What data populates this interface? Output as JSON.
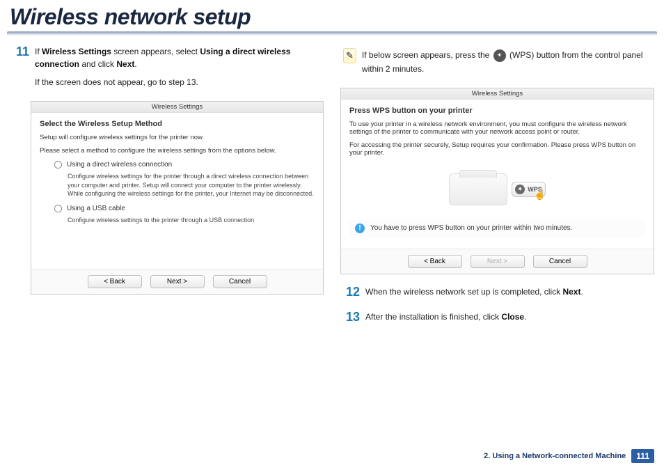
{
  "title": "Wireless network setup",
  "step11": {
    "num": "11",
    "line1_prefix": "If ",
    "line1_b1": "Wireless Settings",
    "line1_mid": " screen appears, select ",
    "line1_b2": "Using a direct wireless connection",
    "line1_end": " and click ",
    "line1_b3": "Next",
    "line1_dot": ".",
    "line2": "If the screen does not appear, go to step 13."
  },
  "dialog1": {
    "title": "Wireless Settings",
    "heading": "Select the Wireless Setup Method",
    "p1": "Setup will configure wireless settings for the printer now.",
    "p2": "Please select a method to configure the wireless settings from the options below.",
    "opt1_label": "Using a direct wireless connection",
    "opt1_desc": "Configure wireless settings for the printer through a direct wireless connection between your computer and printer. Setup will connect your computer to the printer wirelessly.\nWhile configuring the wireless settings for the printer, your Internet may be disconnected.",
    "opt2_label": "Using a USB cable",
    "opt2_desc": "Configure wireless settings to the printer through a USB connection",
    "btn_back": "< Back",
    "btn_next": "Next >",
    "btn_cancel": "Cancel"
  },
  "tip": {
    "text_before": "If below screen appears, press the ",
    "wps_label": "(WPS)",
    "text_after": " button from the control panel within 2 minutes."
  },
  "dialog2": {
    "title": "Wireless Settings",
    "heading": "Press WPS button on your printer",
    "p1": "To use your printer in a wireless network environment, you must configure the wireless network settings of the printer to communicate with your network access point or router.",
    "p2": "For accessing the printer securely, Setup requires your confirmation. Please press WPS button on your printer.",
    "wps_label": "WPS",
    "info": "You have to press WPS button on your printer within two minutes.",
    "btn_back": "< Back",
    "btn_next": "Next >",
    "btn_cancel": "Cancel"
  },
  "step12": {
    "num": "12",
    "text_before": "When the wireless network set up is completed, click ",
    "bold": "Next",
    "dot": "."
  },
  "step13": {
    "num": "13",
    "text_before": "After the installation is finished, click ",
    "bold": "Close",
    "dot": "."
  },
  "footer": {
    "section": "2.  Using a Network-connected Machine",
    "page": "111"
  }
}
